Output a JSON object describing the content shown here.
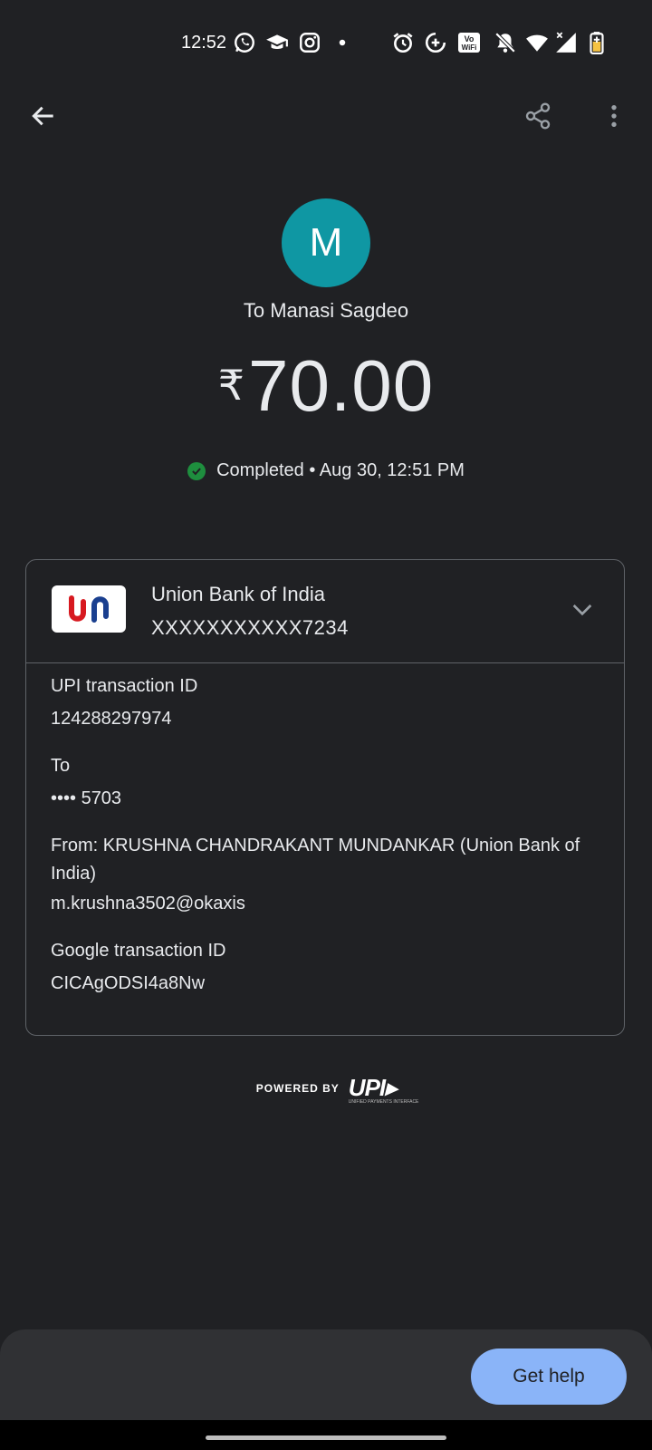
{
  "status_bar": {
    "time": "12:52",
    "icons": [
      "whatsapp-icon",
      "graduation-cap-icon",
      "instagram-icon",
      "dot-icon",
      "alarm-icon",
      "data-saver-icon",
      "vowifi-icon",
      "mute-icon",
      "wifi-icon",
      "signal-icon",
      "battery-icon"
    ],
    "vowifi_top": "Vo",
    "vowifi_bottom": "WiFi"
  },
  "appbar": {
    "back_icon": "arrow-left-icon",
    "share_icon": "share-icon",
    "more_icon": "more-vert-icon"
  },
  "payee": {
    "initial": "M",
    "label": "To Manasi Sagdeo",
    "avatar_color": "#0f97a3"
  },
  "amount": {
    "currency": "₹",
    "value": "70.00"
  },
  "status": {
    "text": "Completed • Aug 30, 12:51 PM",
    "color": "#1e8e3e"
  },
  "bank": {
    "name": "Union Bank of India",
    "account": "XXXXXXXXXXX7234"
  },
  "details": {
    "upi_id_label": "UPI transaction ID",
    "upi_id_value": "124288297974",
    "to_label": "To",
    "to_value": "•••• 5703",
    "from_label": "From: KRUSHNA CHANDRAKANT MUNDANKAR (Union Bank of India)",
    "from_value": "m.krushna3502@okaxis",
    "google_id_label": "Google transaction ID",
    "google_id_value": "CICAgODSI4a8Nw"
  },
  "powered": {
    "label": "POWERED BY",
    "logo": "UPI",
    "logo_sub": "UNIFIED PAYMENTS INTERFACE"
  },
  "help_button": {
    "label": "Get help"
  },
  "colors": {
    "background": "#202124",
    "accent": "#8ab4f8",
    "card_border": "#5f6368"
  }
}
